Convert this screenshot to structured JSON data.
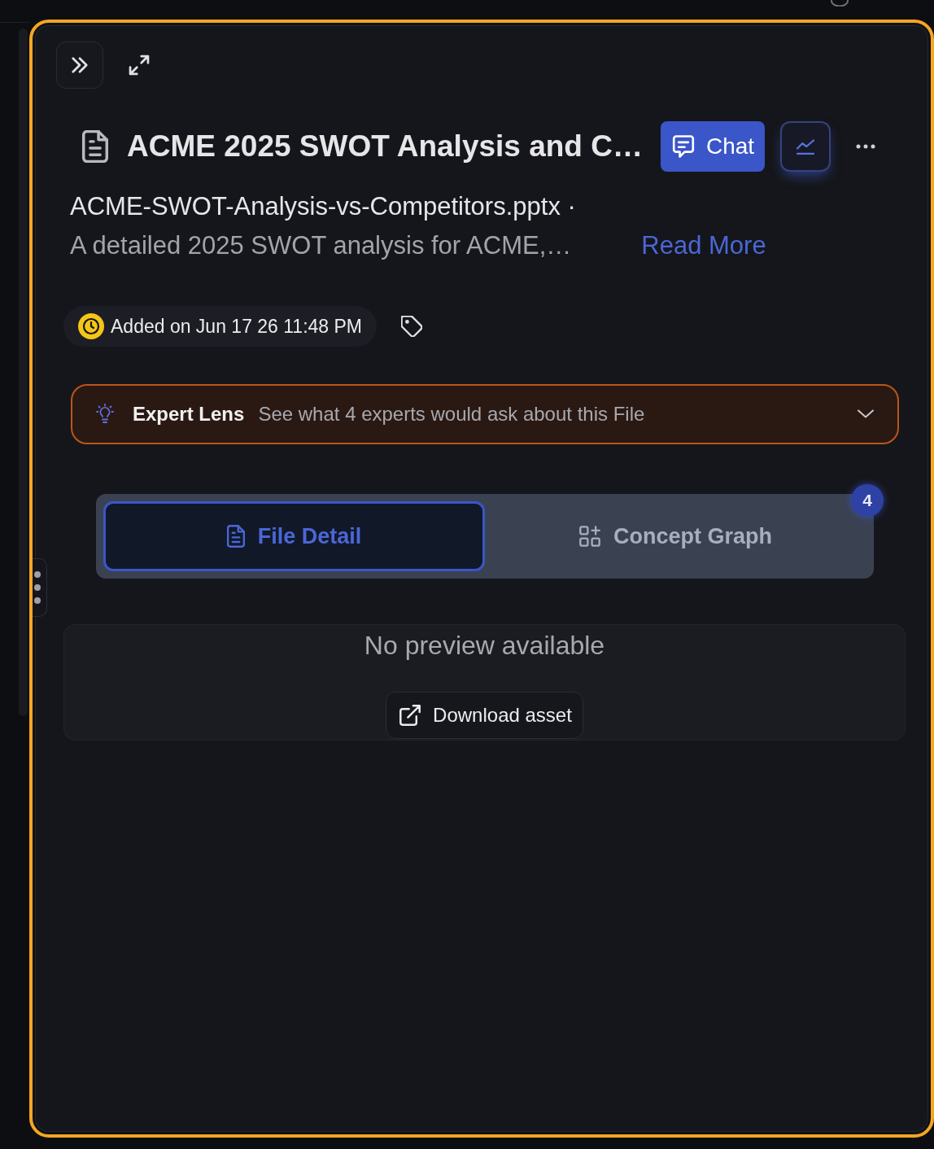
{
  "header": {
    "title": "ACME 2025 SWOT Analysis and C…",
    "chat_button": "Chat",
    "filename": "ACME-SWOT-Analysis-vs-Competitors.pptx ·",
    "description": "A detailed 2025 SWOT analysis for ACME,…",
    "read_more": "Read More"
  },
  "meta": {
    "added_on": "Added on Jun 17 26 11:48 PM"
  },
  "expert_lens": {
    "title": "Expert Lens",
    "subtitle": "See what 4 experts would ask about this File",
    "expanded": false
  },
  "tabs": [
    {
      "label": "File Detail",
      "kind": "file",
      "selected": true
    },
    {
      "label": "Concept Graph",
      "kind": "graph",
      "selected": false,
      "badge": "4"
    }
  ],
  "preview": {
    "message": "No preview available",
    "download_button": "Download asset"
  }
}
